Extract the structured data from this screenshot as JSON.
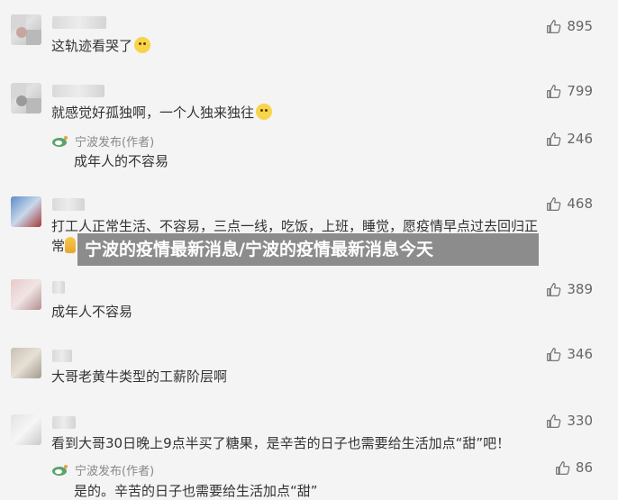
{
  "banner_title": "宁波的疫情最新消息/宁波的疫情最新消息今天",
  "reply_author_name": "宁波发布(作者)",
  "comments": [
    {
      "text": "这轨迹看哭了",
      "emoji": "crying-face",
      "likes": "895"
    },
    {
      "text": "就感觉好孤独啊，一个人独来独往",
      "emoji": "sad-face",
      "likes": "799",
      "reply": {
        "author": "宁波发布(作者)",
        "text": "成年人的不容易",
        "likes": "246"
      }
    },
    {
      "text_line1": "打工人正常生活、不容易，三点一线，吃饭，上班，睡觉，愿疫情早点过去回归正",
      "text_line2": "常",
      "emoji": "pray-hands",
      "likes": "468"
    },
    {
      "text": "成年人不容易",
      "likes": "389"
    },
    {
      "text": "大哥老黄牛类型的工薪阶层啊",
      "likes": "346"
    },
    {
      "text": "看到大哥30日晚上9点半买了糖果，是辛苦的日子也需要给生活加点“甜”吧！",
      "likes": "330",
      "reply": {
        "author": "宁波发布(作者)",
        "text": "是的。辛苦的日子也需要给生活加点“甜”",
        "likes": "86"
      }
    }
  ],
  "icons": {
    "like": "thumbs-up-icon",
    "author_badge": "weibo-logo-icon"
  },
  "colors": {
    "background": "#f4f4f4",
    "text": "#333333",
    "muted": "#888888",
    "banner": "#6e6e6e"
  }
}
